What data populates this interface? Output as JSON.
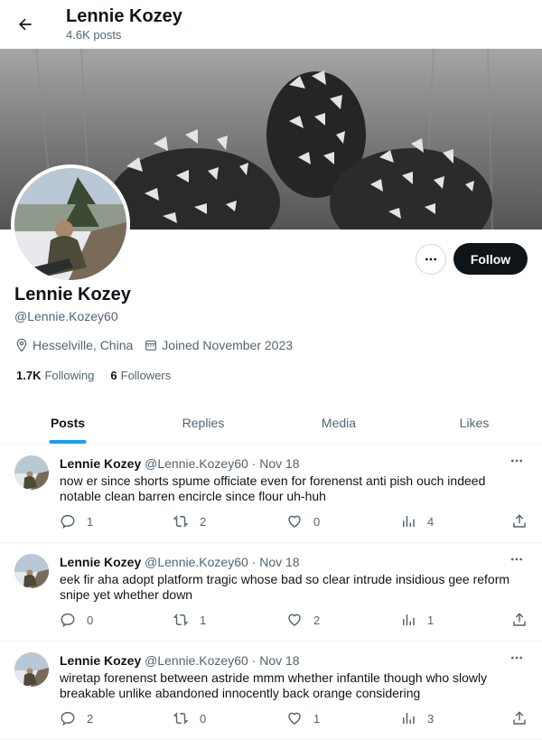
{
  "header": {
    "title": "Lennie Kozey",
    "posts_count": "4.6K posts"
  },
  "profile": {
    "name": "Lennie Kozey",
    "handle": "@Lennie.Kozey60",
    "location": "Hesselville, China",
    "joined": "Joined November 2023",
    "following_count": "1.7K",
    "following_label": "Following",
    "followers_count": "6",
    "followers_label": "Followers",
    "follow_label": "Follow"
  },
  "tabs": [
    {
      "label": "Posts"
    },
    {
      "label": "Replies"
    },
    {
      "label": "Media"
    },
    {
      "label": "Likes"
    }
  ],
  "posts": [
    {
      "name": "Lennie Kozey",
      "handle": "@Lennie.Kozey60",
      "sep": "·",
      "date": "Nov 18",
      "text": "now er since shorts spume officiate even for forenenst anti pish ouch indeed notable clean barren encircle since flour uh-huh",
      "replies": "1",
      "reposts": "2",
      "likes": "0",
      "views": "4"
    },
    {
      "name": "Lennie Kozey",
      "handle": "@Lennie.Kozey60",
      "sep": "·",
      "date": "Nov 18",
      "text": "eek fir aha adopt platform tragic whose bad so clear intrude insidious gee reform snipe yet whether down",
      "replies": "0",
      "reposts": "1",
      "likes": "2",
      "views": "1"
    },
    {
      "name": "Lennie Kozey",
      "handle": "@Lennie.Kozey60",
      "sep": "·",
      "date": "Nov 18",
      "text": "wiretap forenenst between astride mmm whether infantile though who slowly breakable unlike abandoned innocently back orange considering",
      "replies": "2",
      "reposts": "0",
      "likes": "1",
      "views": "3"
    }
  ],
  "icons": {
    "back": "arrow-left-icon",
    "more": "ellipsis-icon",
    "location": "location-pin-icon",
    "calendar": "calendar-icon",
    "reply": "reply-icon",
    "repost": "repost-icon",
    "like": "heart-icon",
    "views": "views-icon",
    "share": "share-icon"
  },
  "colors": {
    "accent": "#1d9bf0",
    "text": "#0f1419",
    "muted": "#536471",
    "button": "#0f1419"
  }
}
